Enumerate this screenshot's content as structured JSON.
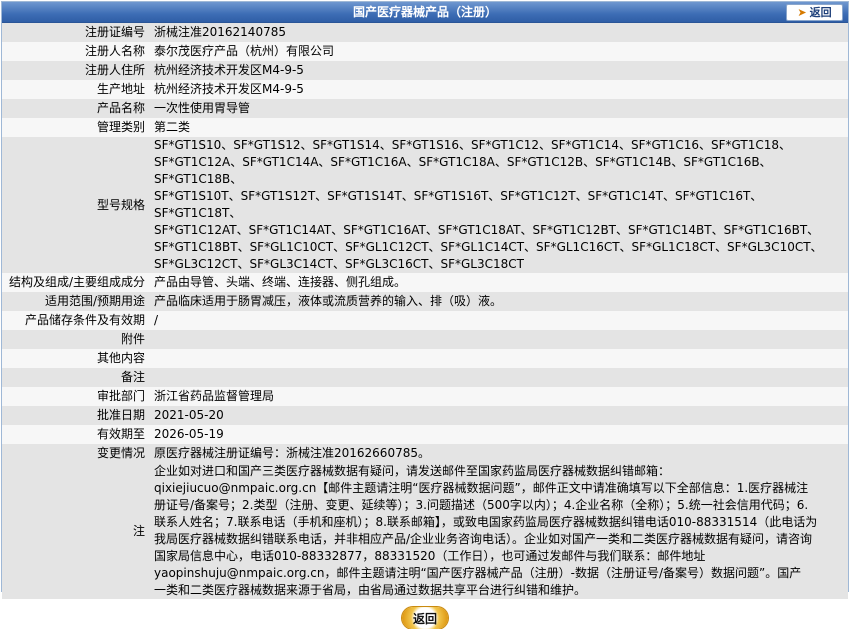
{
  "header": {
    "title": "国产医疗器械产品（注册）",
    "back_label": "返回"
  },
  "fields": {
    "reg_no": {
      "label": "注册证编号",
      "value": "浙械注准20162140785"
    },
    "registrant": {
      "label": "注册人名称",
      "value": "泰尔茂医疗产品（杭州）有限公司"
    },
    "registrant_addr": {
      "label": "注册人住所",
      "value": "杭州经济技术开发区M4-9-5"
    },
    "prod_addr": {
      "label": "生产地址",
      "value": "杭州经济技术开发区M4-9-5"
    },
    "product_name": {
      "label": "产品名称",
      "value": "一次性使用胃导管"
    },
    "category": {
      "label": "管理类别",
      "value": "第二类"
    },
    "models": {
      "label": "型号规格",
      "lines": [
        "SF*GT1S10、SF*GT1S12、SF*GT1S14、SF*GT1S16、SF*GT1C12、SF*GT1C14、SF*GT1C16、SF*GT1C18、",
        "SF*GT1C12A、SF*GT1C14A、SF*GT1C16A、SF*GT1C18A、SF*GT1C12B、SF*GT1C14B、SF*GT1C16B、SF*GT1C18B、",
        "SF*GT1S10T、SF*GT1S12T、SF*GT1S14T、SF*GT1S16T、SF*GT1C12T、SF*GT1C14T、SF*GT1C16T、SF*GT1C18T、",
        "SF*GT1C12AT、SF*GT1C14AT、SF*GT1C16AT、SF*GT1C18AT、SF*GT1C12BT、SF*GT1C14BT、SF*GT1C16BT、",
        "SF*GT1C18BT、SF*GL1C10CT、SF*GL1C12CT、SF*GL1C14CT、SF*GL1C16CT、SF*GL1C18CT、SF*GL3C10CT、",
        "SF*GL3C12CT、SF*GL3C14CT、SF*GL3C16CT、SF*GL3C18CT"
      ]
    },
    "structure": {
      "label": "结构及组成/主要组成成分",
      "value": "产品由导管、头端、终端、连接器、侧孔组成。"
    },
    "scope": {
      "label": "适用范围/预期用途",
      "value": "产品临床适用于肠胃减压，液体或流质营养的输入、排（吸）液。"
    },
    "storage": {
      "label": "产品储存条件及有效期",
      "value": "/"
    },
    "attachment": {
      "label": "附件",
      "value": ""
    },
    "other": {
      "label": "其他内容",
      "value": ""
    },
    "remark": {
      "label": "备注",
      "value": ""
    },
    "dept": {
      "label": "审批部门",
      "value": "浙江省药品监督管理局"
    },
    "approval_date": {
      "label": "批准日期",
      "value": "2021-05-20"
    },
    "valid_until": {
      "label": "有效期至",
      "value": "2026-05-19"
    },
    "change": {
      "label": "变更情况",
      "value": "原医疗器械注册证编号：浙械注准20162660785。"
    },
    "note": {
      "label": "注",
      "lines": [
        "企业如对进口和国产三类医疗器械数据有疑问，请发送邮件至国家药监局医疗器械数据纠错邮箱：",
        "qixiejiucuo@nmpaic.org.cn【邮件主题请注明“医疗器械数据问题”，邮件正文中请准确填写以下全部信息：1.医疗器械注",
        "册证号/备案号；2.类型（注册、变更、延续等）；3.问题描述（500字以内）；4.企业名称（全称）；5.统一社会信用代码；6.",
        "联系人姓名；7.联系电话（手机和座机）；8.联系邮箱】，或致电国家药监局医疗器械数据纠错电话010-88331514（此电话为",
        "我局医疗器械数据纠错联系电话，并非相应产品/企业业务咨询电话）。企业如对国产一类和二类医疗器械数据有疑问，请咨询",
        "国家局信息中心，电话010-88332877，88331520（工作日），也可通过发邮件与我们联系：邮件地址",
        "yaopinshuju@nmpaic.org.cn，邮件主题请注明“国产医疗器械产品（注册）-数据（注册证号/备案号）数据问题”。国产",
        "一类和二类医疗器械数据来源于省局，由省局通过数据共享平台进行纠错和维护。"
      ]
    }
  },
  "colors": {
    "title_bar": "#3d6db5",
    "row_odd": "#e4e4e4",
    "row_even": "#f7f7f7",
    "border": "#9fb8d6"
  }
}
